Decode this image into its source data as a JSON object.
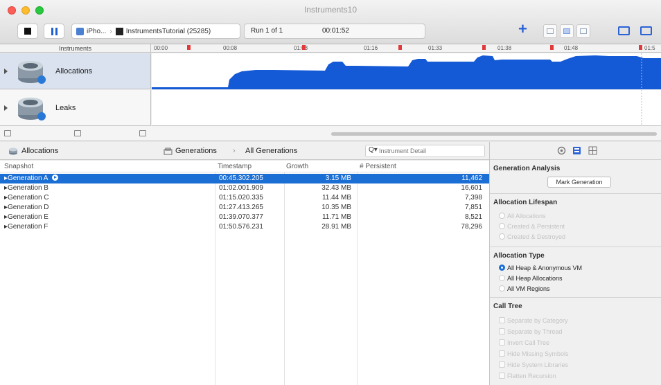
{
  "window": {
    "title": "Instruments10"
  },
  "toolbar": {
    "target_device": "iPho...",
    "target_app": "InstrumentsTutorial (25285)",
    "run_label": "Run 1 of 1",
    "elapsed_time": "00:01:52"
  },
  "ruler": {
    "label": "Instruments",
    "ticks": [
      "00:00",
      "00:08",
      "01:08",
      "01:16",
      "01:33",
      "01:38",
      "01:48",
      "01:5"
    ]
  },
  "tracks": [
    {
      "name": "Allocations",
      "icon": "allocations-icon"
    },
    {
      "name": "Leaks",
      "icon": "leaks-icon"
    }
  ],
  "jumpbar": {
    "instrument": "Allocations",
    "view": "Generations",
    "scope": "All Generations",
    "filter_placeholder": "Instrument Detail"
  },
  "table": {
    "headers": {
      "snapshot": "Snapshot",
      "timestamp": "Timestamp",
      "growth": "Growth",
      "persistent": "# Persistent"
    },
    "rows": [
      {
        "snapshot": "Generation A",
        "timestamp": "00:45.302.205",
        "growth": "3.15 MB",
        "persistent": "11,462",
        "selected": true
      },
      {
        "snapshot": "Generation B",
        "timestamp": "01:02.001.909",
        "growth": "32.43 MB",
        "persistent": "16,601"
      },
      {
        "snapshot": "Generation C",
        "timestamp": "01:15.020.335",
        "growth": "11.44 MB",
        "persistent": "7,398"
      },
      {
        "snapshot": "Generation D",
        "timestamp": "01:27.413.265",
        "growth": "10.35 MB",
        "persistent": "7,851"
      },
      {
        "snapshot": "Generation E",
        "timestamp": "01:39.070.377",
        "growth": "11.71 MB",
        "persistent": "8,521"
      },
      {
        "snapshot": "Generation F",
        "timestamp": "01:50.576.231",
        "growth": "28.91 MB",
        "persistent": "78,296"
      }
    ]
  },
  "inspector": {
    "generation_analysis": {
      "title": "Generation Analysis",
      "mark_button": "Mark Generation"
    },
    "allocation_lifespan": {
      "title": "Allocation Lifespan",
      "options": [
        "All Allocations",
        "Created & Persistent",
        "Created & Destroyed"
      ]
    },
    "allocation_type": {
      "title": "Allocation Type",
      "options": [
        "All Heap & Anonymous VM",
        "All Heap Allocations",
        "All VM Regions"
      ],
      "selected": "All Heap & Anonymous VM"
    },
    "call_tree": {
      "title": "Call Tree",
      "options": [
        "Separate by Category",
        "Separate by Thread",
        "Invert Call Tree",
        "Hide Missing Symbols",
        "Hide System Libraries",
        "Flatten Recursion"
      ]
    }
  },
  "colors": {
    "accent": "#1b6ed4",
    "graph_fill": "#1459d6",
    "marker": "#e03a3a"
  }
}
